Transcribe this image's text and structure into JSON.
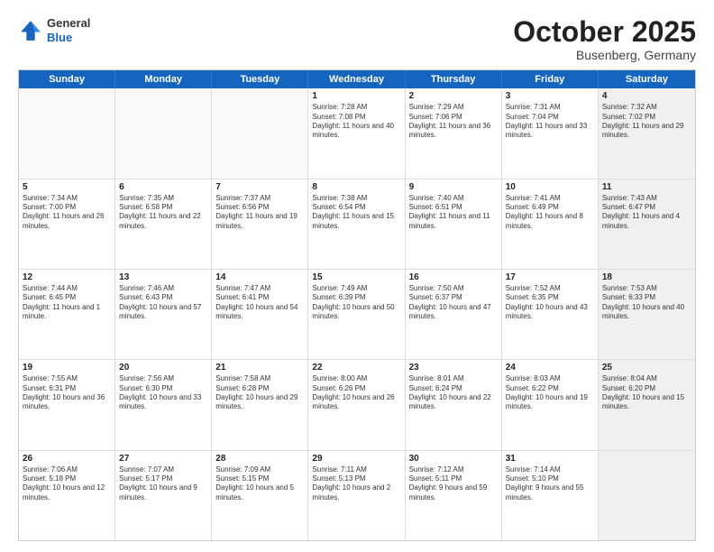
{
  "logo": {
    "general": "General",
    "blue": "Blue"
  },
  "header": {
    "month": "October 2025",
    "location": "Busenberg, Germany"
  },
  "weekdays": [
    "Sunday",
    "Monday",
    "Tuesday",
    "Wednesday",
    "Thursday",
    "Friday",
    "Saturday"
  ],
  "rows": [
    [
      {
        "day": "",
        "text": "",
        "empty": true,
        "shaded": false
      },
      {
        "day": "",
        "text": "",
        "empty": true,
        "shaded": false
      },
      {
        "day": "",
        "text": "",
        "empty": true,
        "shaded": false
      },
      {
        "day": "1",
        "text": "Sunrise: 7:28 AM\nSunset: 7:08 PM\nDaylight: 11 hours and 40 minutes.",
        "empty": false,
        "shaded": false
      },
      {
        "day": "2",
        "text": "Sunrise: 7:29 AM\nSunset: 7:06 PM\nDaylight: 11 hours and 36 minutes.",
        "empty": false,
        "shaded": false
      },
      {
        "day": "3",
        "text": "Sunrise: 7:31 AM\nSunset: 7:04 PM\nDaylight: 11 hours and 33 minutes.",
        "empty": false,
        "shaded": false
      },
      {
        "day": "4",
        "text": "Sunrise: 7:32 AM\nSunset: 7:02 PM\nDaylight: 11 hours and 29 minutes.",
        "empty": false,
        "shaded": true
      }
    ],
    [
      {
        "day": "5",
        "text": "Sunrise: 7:34 AM\nSunset: 7:00 PM\nDaylight: 11 hours and 26 minutes.",
        "empty": false,
        "shaded": false
      },
      {
        "day": "6",
        "text": "Sunrise: 7:35 AM\nSunset: 6:58 PM\nDaylight: 11 hours and 22 minutes.",
        "empty": false,
        "shaded": false
      },
      {
        "day": "7",
        "text": "Sunrise: 7:37 AM\nSunset: 6:56 PM\nDaylight: 11 hours and 19 minutes.",
        "empty": false,
        "shaded": false
      },
      {
        "day": "8",
        "text": "Sunrise: 7:38 AM\nSunset: 6:54 PM\nDaylight: 11 hours and 15 minutes.",
        "empty": false,
        "shaded": false
      },
      {
        "day": "9",
        "text": "Sunrise: 7:40 AM\nSunset: 6:51 PM\nDaylight: 11 hours and 11 minutes.",
        "empty": false,
        "shaded": false
      },
      {
        "day": "10",
        "text": "Sunrise: 7:41 AM\nSunset: 6:49 PM\nDaylight: 11 hours and 8 minutes.",
        "empty": false,
        "shaded": false
      },
      {
        "day": "11",
        "text": "Sunrise: 7:43 AM\nSunset: 6:47 PM\nDaylight: 11 hours and 4 minutes.",
        "empty": false,
        "shaded": true
      }
    ],
    [
      {
        "day": "12",
        "text": "Sunrise: 7:44 AM\nSunset: 6:45 PM\nDaylight: 11 hours and 1 minute.",
        "empty": false,
        "shaded": false
      },
      {
        "day": "13",
        "text": "Sunrise: 7:46 AM\nSunset: 6:43 PM\nDaylight: 10 hours and 57 minutes.",
        "empty": false,
        "shaded": false
      },
      {
        "day": "14",
        "text": "Sunrise: 7:47 AM\nSunset: 6:41 PM\nDaylight: 10 hours and 54 minutes.",
        "empty": false,
        "shaded": false
      },
      {
        "day": "15",
        "text": "Sunrise: 7:49 AM\nSunset: 6:39 PM\nDaylight: 10 hours and 50 minutes.",
        "empty": false,
        "shaded": false
      },
      {
        "day": "16",
        "text": "Sunrise: 7:50 AM\nSunset: 6:37 PM\nDaylight: 10 hours and 47 minutes.",
        "empty": false,
        "shaded": false
      },
      {
        "day": "17",
        "text": "Sunrise: 7:52 AM\nSunset: 6:35 PM\nDaylight: 10 hours and 43 minutes.",
        "empty": false,
        "shaded": false
      },
      {
        "day": "18",
        "text": "Sunrise: 7:53 AM\nSunset: 6:33 PM\nDaylight: 10 hours and 40 minutes.",
        "empty": false,
        "shaded": true
      }
    ],
    [
      {
        "day": "19",
        "text": "Sunrise: 7:55 AM\nSunset: 6:31 PM\nDaylight: 10 hours and 36 minutes.",
        "empty": false,
        "shaded": false
      },
      {
        "day": "20",
        "text": "Sunrise: 7:56 AM\nSunset: 6:30 PM\nDaylight: 10 hours and 33 minutes.",
        "empty": false,
        "shaded": false
      },
      {
        "day": "21",
        "text": "Sunrise: 7:58 AM\nSunset: 6:28 PM\nDaylight: 10 hours and 29 minutes.",
        "empty": false,
        "shaded": false
      },
      {
        "day": "22",
        "text": "Sunrise: 8:00 AM\nSunset: 6:26 PM\nDaylight: 10 hours and 26 minutes.",
        "empty": false,
        "shaded": false
      },
      {
        "day": "23",
        "text": "Sunrise: 8:01 AM\nSunset: 6:24 PM\nDaylight: 10 hours and 22 minutes.",
        "empty": false,
        "shaded": false
      },
      {
        "day": "24",
        "text": "Sunrise: 8:03 AM\nSunset: 6:22 PM\nDaylight: 10 hours and 19 minutes.",
        "empty": false,
        "shaded": false
      },
      {
        "day": "25",
        "text": "Sunrise: 8:04 AM\nSunset: 6:20 PM\nDaylight: 10 hours and 15 minutes.",
        "empty": false,
        "shaded": true
      }
    ],
    [
      {
        "day": "26",
        "text": "Sunrise: 7:06 AM\nSunset: 5:18 PM\nDaylight: 10 hours and 12 minutes.",
        "empty": false,
        "shaded": false
      },
      {
        "day": "27",
        "text": "Sunrise: 7:07 AM\nSunset: 5:17 PM\nDaylight: 10 hours and 9 minutes.",
        "empty": false,
        "shaded": false
      },
      {
        "day": "28",
        "text": "Sunrise: 7:09 AM\nSunset: 5:15 PM\nDaylight: 10 hours and 5 minutes.",
        "empty": false,
        "shaded": false
      },
      {
        "day": "29",
        "text": "Sunrise: 7:11 AM\nSunset: 5:13 PM\nDaylight: 10 hours and 2 minutes.",
        "empty": false,
        "shaded": false
      },
      {
        "day": "30",
        "text": "Sunrise: 7:12 AM\nSunset: 5:11 PM\nDaylight: 9 hours and 59 minutes.",
        "empty": false,
        "shaded": false
      },
      {
        "day": "31",
        "text": "Sunrise: 7:14 AM\nSunset: 5:10 PM\nDaylight: 9 hours and 55 minutes.",
        "empty": false,
        "shaded": false
      },
      {
        "day": "",
        "text": "",
        "empty": true,
        "shaded": true
      }
    ]
  ]
}
